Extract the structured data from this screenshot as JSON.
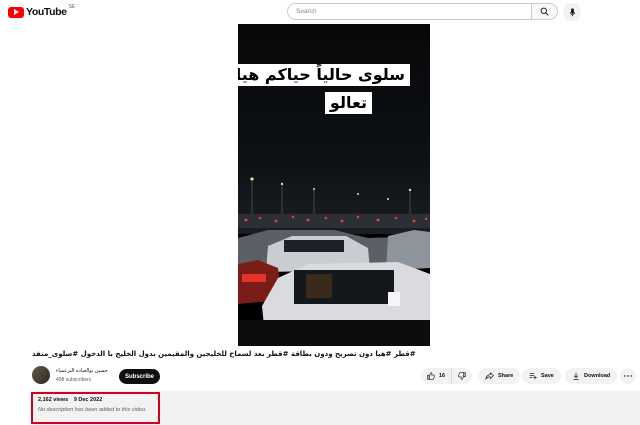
{
  "header": {
    "logo_text": "YouTube",
    "country_code": "SE",
    "search_placeholder": "Search",
    "icons": {
      "search": "search-icon",
      "mic": "mic-icon"
    }
  },
  "video": {
    "overlay_line1": "سلوى حالياً حياكم هيا",
    "overlay_line2": "تعالو",
    "title": "#قطر #هيا دون تصريح ودون بطاقة #قطر بعد لسماح للخليجين والمقيمين بدول الخليج با الدخول #سلوى_منفذ"
  },
  "channel": {
    "name": "حسين بوالعياده البزعمياء",
    "subscribers": "498 subscribers",
    "subscribe_label": "Subscribe"
  },
  "actions": {
    "likes": "16",
    "share_label": "Share",
    "save_label": "Save",
    "download_label": "Download"
  },
  "description": {
    "views": "2,162 views",
    "date": "9 Dec 2022",
    "text": "No description has been added to this video."
  },
  "colors": {
    "brand": "#ff0000",
    "highlight": "#d0021b",
    "subscribe": "#0f0f0f"
  }
}
